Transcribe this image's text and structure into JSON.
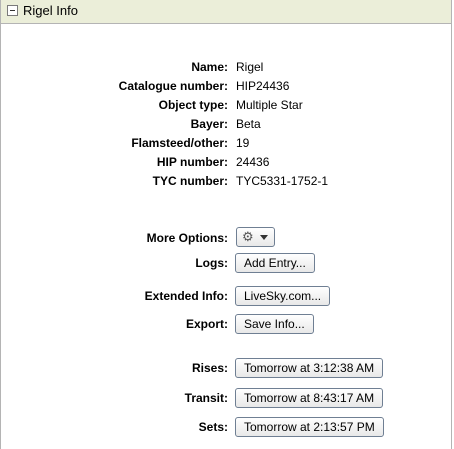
{
  "header": {
    "title": "Rigel Info"
  },
  "fields": [
    {
      "label": "Name:",
      "value": "Rigel"
    },
    {
      "label": "Catalogue number:",
      "value": "HIP24436"
    },
    {
      "label": "Object type:",
      "value": "Multiple Star"
    },
    {
      "label": "Bayer:",
      "value": "Beta"
    },
    {
      "label": "Flamsteed/other:",
      "value": "19"
    },
    {
      "label": "HIP number:",
      "value": "24436"
    },
    {
      "label": "TYC number:",
      "value": "TYC5331-1752-1"
    }
  ],
  "actions": {
    "more_options_label": "More Options:",
    "more_options_icon": "gear-icon",
    "logs_label": "Logs:",
    "logs_button": "Add Entry...",
    "extended_label": "Extended Info:",
    "extended_button": "LiveSky.com...",
    "export_label": "Export:",
    "export_button": "Save Info..."
  },
  "times": {
    "rises_label": "Rises:",
    "rises_button": "Tomorrow at 3:12:38 AM",
    "transit_label": "Transit:",
    "transit_button": "Tomorrow at 8:43:17 AM",
    "sets_label": "Sets:",
    "sets_button": "Tomorrow at 2:13:57 PM"
  }
}
